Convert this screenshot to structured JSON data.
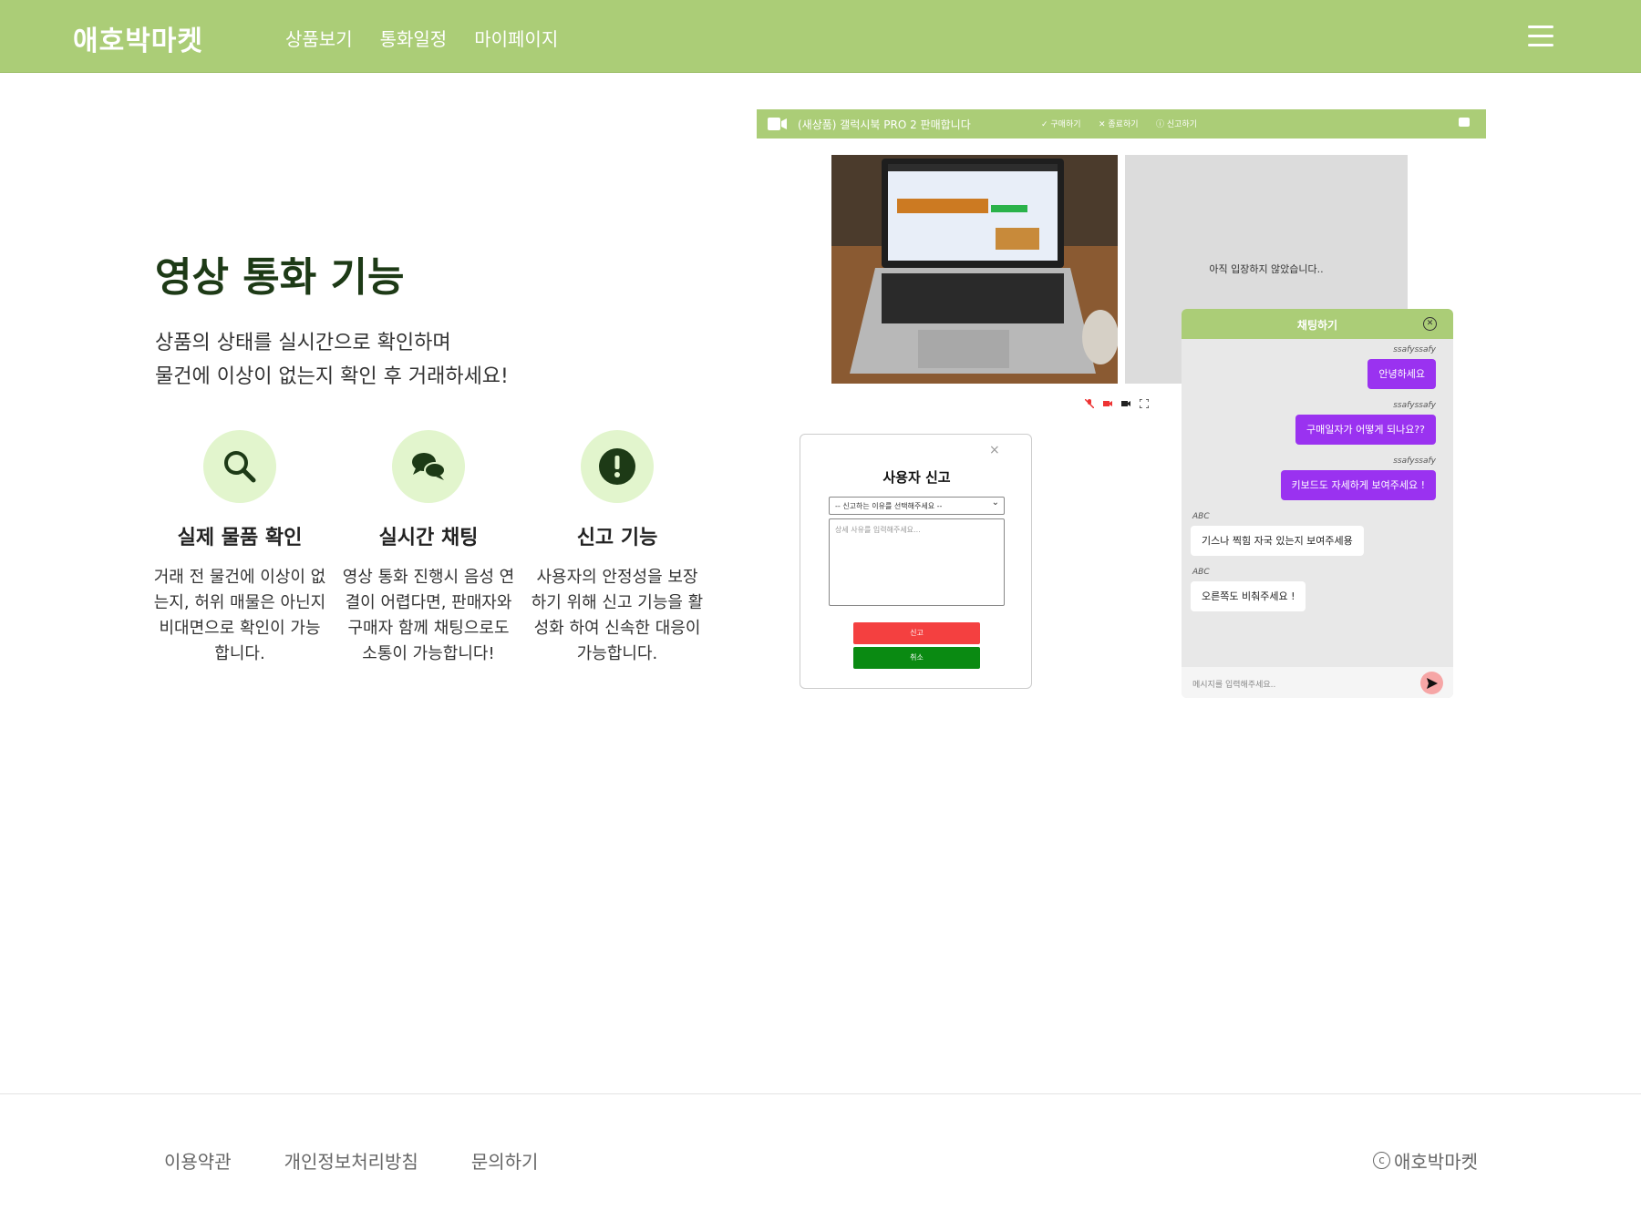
{
  "header": {
    "logo": "애호박마켓",
    "nav": [
      "상품보기",
      "통화일정",
      "마이페이지"
    ]
  },
  "hero": {
    "title": "영상 통화 기능",
    "desc_line1": "상품의 상태를 실시간으로 확인하며",
    "desc_line2": "물건에 이상이 없는지 확인 후 거래하세요!"
  },
  "features": [
    {
      "icon": "search-icon",
      "title": "실제 물품 확인",
      "desc": "거래 전 물건에 이상이 없는지, 허위 매물은 아닌지 비대면으로 확인이 가능합니다."
    },
    {
      "icon": "chat-bubbles-icon",
      "title": "실시간 채팅",
      "desc": "영상 통화 진행시 음성 연결이 어렵다면, 판매자와 구매자 함께 채팅으로도 소통이 가능합니다!"
    },
    {
      "icon": "exclamation-icon",
      "title": "신고 기능",
      "desc": "사용자의 안정성을 보장하기 위해 신고 기능을 활성화 하여 신속한 대응이 가능합니다."
    }
  ],
  "mock": {
    "call_title": "(새상품) 갤럭시북 PRO 2 판매합니다",
    "buy": "구매하기",
    "end": "종료하기",
    "report": "신고하기",
    "waiting": "아직 입장하지 않았습니다.."
  },
  "modal": {
    "title": "사용자 신고",
    "close": "×",
    "select_placeholder": "-- 신고하는 이유를 선택해주세요 --",
    "textarea_placeholder": "상세 사유를 입력해주세요...",
    "report_btn": "신고",
    "cancel_btn": "취소"
  },
  "chat": {
    "title": "채팅하기",
    "messages": [
      {
        "sender": "ssafyssafy",
        "text": "안녕하세요",
        "mine": true
      },
      {
        "sender": "ssafyssafy",
        "text": "구매일자가 어떻게 되나요??",
        "mine": true
      },
      {
        "sender": "ssafyssafy",
        "text": "키보드도 자세하게 보여주세요 !",
        "mine": true
      },
      {
        "sender": "ABC",
        "text": "기스나 찍힘 자국 있는지 보여주세용",
        "mine": false
      },
      {
        "sender": "ABC",
        "text": "오른쪽도 비춰주세요 !",
        "mine": false
      }
    ],
    "input_placeholder": "메시지를 입력해주세요.."
  },
  "footer": {
    "links": [
      "이용약관",
      "개인정보처리방침",
      "문의하기"
    ],
    "copyright_mark": "c",
    "copyright": "애호박마켓"
  },
  "colors": {
    "header_green": "#abcd77",
    "title_green": "#1d3a16",
    "feature_circle": "#e2f5cd",
    "chat_mine": "#9a32f0",
    "report_red": "#f44040",
    "cancel_green": "#0a8a12"
  }
}
